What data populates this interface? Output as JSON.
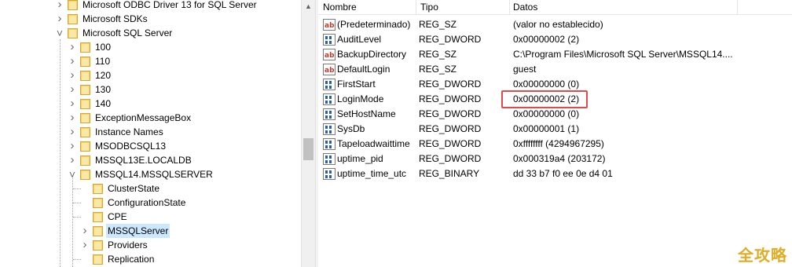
{
  "tree": {
    "items": [
      {
        "label": "Microsoft ODBC Driver 13 for SQL Server",
        "level": 0,
        "expander": "collapsed"
      },
      {
        "label": "Microsoft SDKs",
        "level": 0,
        "expander": "collapsed"
      },
      {
        "label": "Microsoft SQL Server",
        "level": 0,
        "expander": "expanded"
      },
      {
        "label": "100",
        "level": 1,
        "expander": "collapsed"
      },
      {
        "label": "110",
        "level": 1,
        "expander": "collapsed"
      },
      {
        "label": "120",
        "level": 1,
        "expander": "collapsed"
      },
      {
        "label": "130",
        "level": 1,
        "expander": "collapsed"
      },
      {
        "label": "140",
        "level": 1,
        "expander": "collapsed"
      },
      {
        "label": "ExceptionMessageBox",
        "level": 1,
        "expander": "collapsed"
      },
      {
        "label": "Instance Names",
        "level": 1,
        "expander": "collapsed"
      },
      {
        "label": "MSODBCSQL13",
        "level": 1,
        "expander": "collapsed"
      },
      {
        "label": "MSSQL13E.LOCALDB",
        "level": 1,
        "expander": "collapsed"
      },
      {
        "label": "MSSQL14.MSSQLSERVER",
        "level": 1,
        "expander": "expanded"
      },
      {
        "label": "ClusterState",
        "level": 2,
        "expander": "none"
      },
      {
        "label": "ConfigurationState",
        "level": 2,
        "expander": "none"
      },
      {
        "label": "CPE",
        "level": 2,
        "expander": "none"
      },
      {
        "label": "MSSQLServer",
        "level": 2,
        "expander": "collapsed",
        "selected": true
      },
      {
        "label": "Providers",
        "level": 2,
        "expander": "collapsed"
      },
      {
        "label": "Replication",
        "level": 2,
        "expander": "none"
      }
    ]
  },
  "values": {
    "columns": {
      "name": "Nombre",
      "type": "Tipo",
      "data": "Datos"
    },
    "rows": [
      {
        "icon": "string-value-icon",
        "name": "(Predeterminado)",
        "type": "REG_SZ",
        "data": "(valor no establecido)"
      },
      {
        "icon": "binary-value-icon",
        "name": "AuditLevel",
        "type": "REG_DWORD",
        "data": "0x00000002 (2)"
      },
      {
        "icon": "string-value-icon",
        "name": "BackupDirectory",
        "type": "REG_SZ",
        "data": "C:\\Program Files\\Microsoft SQL Server\\MSSQL14...."
      },
      {
        "icon": "string-value-icon",
        "name": "DefaultLogin",
        "type": "REG_SZ",
        "data": "guest"
      },
      {
        "icon": "binary-value-icon",
        "name": "FirstStart",
        "type": "REG_DWORD",
        "data": "0x00000000 (0)"
      },
      {
        "icon": "binary-value-icon",
        "name": "LoginMode",
        "type": "REG_DWORD",
        "data": "0x00000002 (2)",
        "highlighted": true
      },
      {
        "icon": "binary-value-icon",
        "name": "SetHostName",
        "type": "REG_DWORD",
        "data": "0x00000000 (0)"
      },
      {
        "icon": "binary-value-icon",
        "name": "SysDb",
        "type": "REG_DWORD",
        "data": "0x00000001 (1)"
      },
      {
        "icon": "binary-value-icon",
        "name": "Tapeloadwaittime",
        "type": "REG_DWORD",
        "data": "0xffffffff (4294967295)"
      },
      {
        "icon": "binary-value-icon",
        "name": "uptime_pid",
        "type": "REG_DWORD",
        "data": "0x000319a4 (203172)"
      },
      {
        "icon": "binary-value-icon",
        "name": "uptime_time_utc",
        "type": "REG_BINARY",
        "data": "dd 33 b7 f0 ee 0e d4 01"
      }
    ]
  },
  "colors": {
    "highlight_border": "#e04a4a",
    "folder": "#f5d06a",
    "selection": "#cce8ff"
  },
  "watermark": "全攻略"
}
